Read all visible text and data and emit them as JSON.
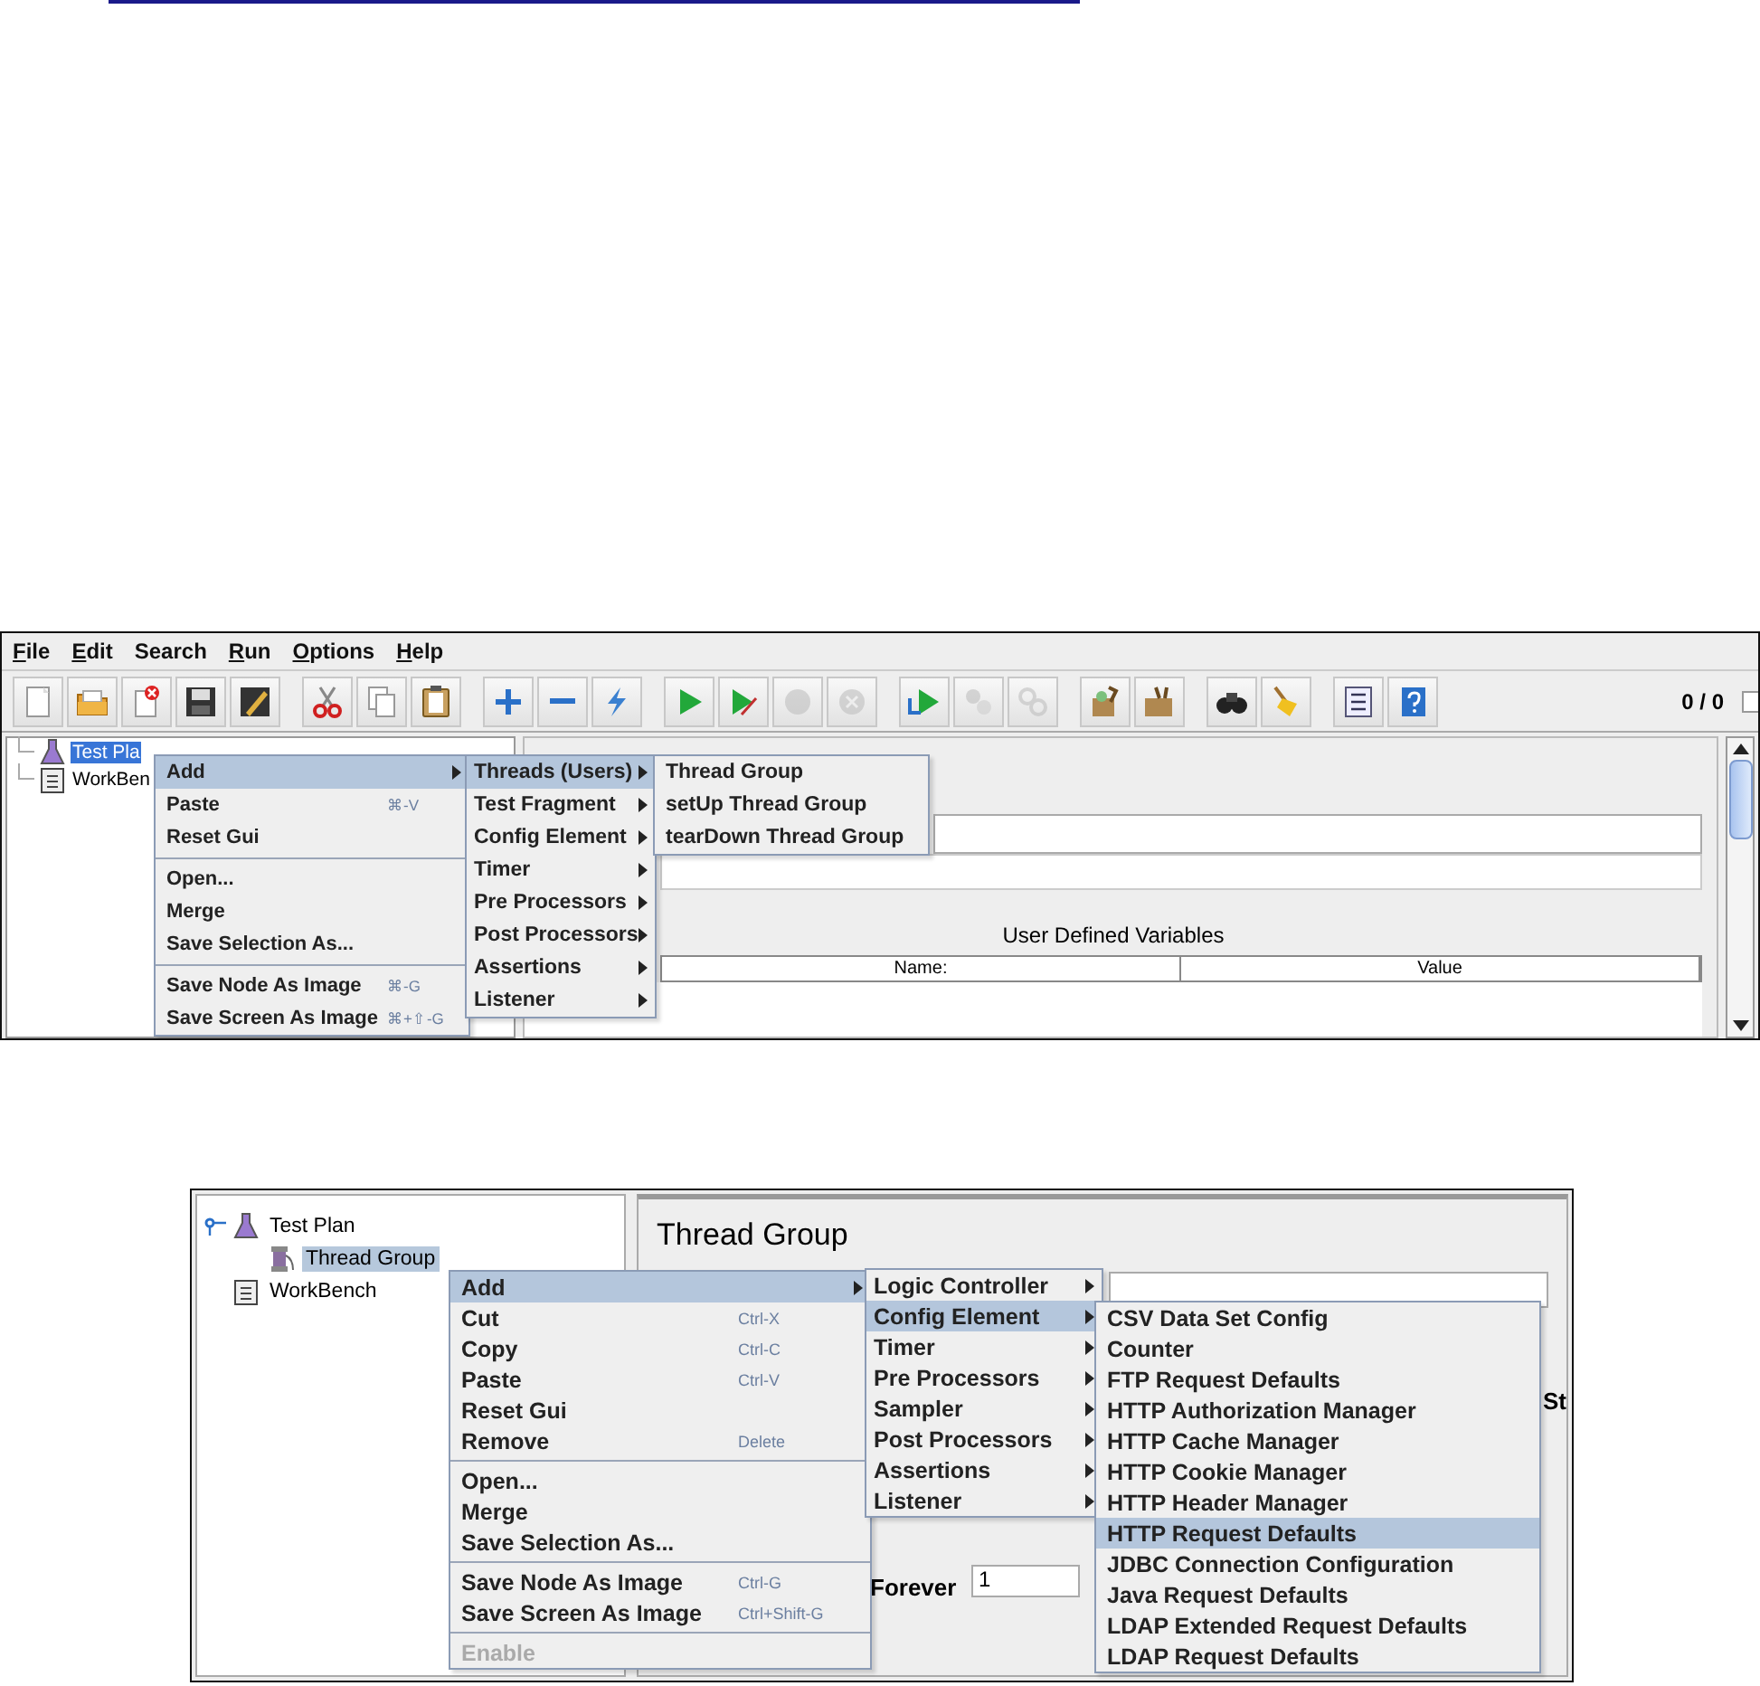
{
  "screenshot_1": {
    "menubar": [
      {
        "label": "File",
        "mnemonic": true
      },
      {
        "label": "Edit",
        "mnemonic": true
      },
      {
        "label": "Search",
        "mnemonic": false
      },
      {
        "label": "Run",
        "mnemonic": true
      },
      {
        "label": "Options",
        "mnemonic": true
      },
      {
        "label": "Help",
        "mnemonic": true
      }
    ],
    "toolbar_buttons": [
      {
        "disabled": false
      },
      {
        "disabled": false
      },
      {
        "disabled": false
      },
      {
        "disabled": false
      },
      {
        "disabled": false
      },
      {
        "disabled": false
      },
      {
        "disabled": false
      },
      {
        "disabled": false
      },
      {
        "disabled": false
      },
      {
        "disabled": false
      },
      {
        "disabled": false
      },
      {
        "disabled": false
      },
      {
        "disabled": false
      },
      {
        "disabled": true
      },
      {
        "disabled": true
      },
      {
        "disabled": false
      },
      {
        "disabled": true
      },
      {
        "disabled": true
      },
      {
        "disabled": false
      },
      {
        "disabled": false
      },
      {
        "disabled": false
      },
      {
        "disabled": false
      },
      {
        "disabled": false
      },
      {
        "disabled": false
      }
    ],
    "counter": "0 / 0",
    "tree": [
      {
        "label": "Test Pla",
        "selected": true
      },
      {
        "label": "WorkBen",
        "selected": false
      }
    ],
    "context_menu": {
      "items": [
        {
          "kind": "item",
          "label": "Add",
          "selected": true,
          "submenu": true
        },
        {
          "kind": "item",
          "label": "Paste",
          "shortcut": "⌘-V",
          "selected": false,
          "submenu": false
        },
        {
          "kind": "item",
          "label": "Reset Gui",
          "selected": false,
          "submenu": false
        },
        {
          "kind": "separator"
        },
        {
          "kind": "item",
          "label": "Open...",
          "selected": false,
          "submenu": false
        },
        {
          "kind": "item",
          "label": "Merge",
          "selected": false,
          "submenu": false
        },
        {
          "kind": "item",
          "label": "Save Selection As...",
          "selected": false,
          "submenu": false
        },
        {
          "kind": "separator"
        },
        {
          "kind": "item",
          "label": "Save Node As Image",
          "shortcut": "⌘-G",
          "selected": false,
          "submenu": false
        },
        {
          "kind": "item",
          "label": "Save Screen As Image",
          "shortcut": "⌘+⇧-G",
          "selected": false,
          "submenu": false
        }
      ]
    },
    "submenu_1": {
      "items": [
        {
          "kind": "item",
          "label": "Threads (Users)",
          "selected": true,
          "submenu": true
        },
        {
          "kind": "item",
          "label": "Test Fragment",
          "selected": false,
          "submenu": true
        },
        {
          "kind": "item",
          "label": "Config Element",
          "selected": false,
          "submenu": true
        },
        {
          "kind": "item",
          "label": "Timer",
          "selected": false,
          "submenu": true
        },
        {
          "kind": "item",
          "label": "Pre Processors",
          "selected": false,
          "submenu": true
        },
        {
          "kind": "item",
          "label": "Post Processors",
          "selected": false,
          "submenu": true
        },
        {
          "kind": "item",
          "label": "Assertions",
          "selected": false,
          "submenu": true
        },
        {
          "kind": "item",
          "label": "Listener",
          "selected": false,
          "submenu": true
        }
      ]
    },
    "submenu_2": {
      "items": [
        {
          "kind": "item",
          "label": "Thread Group",
          "selected": false,
          "submenu": false
        },
        {
          "kind": "item",
          "label": "setUp Thread Group",
          "selected": false,
          "submenu": false
        },
        {
          "kind": "item",
          "label": "tearDown Thread Group",
          "selected": false,
          "submenu": false
        }
      ]
    },
    "panel": {
      "table_title": "User Defined Variables",
      "columns": [
        "Name:",
        "Value"
      ]
    }
  },
  "screenshot_2": {
    "tree": [
      {
        "label": "Test Plan",
        "selected": false,
        "expanded": true,
        "children": [
          {
            "label": "Thread Group",
            "selected": true
          }
        ]
      },
      {
        "label": "WorkBench",
        "selected": false
      }
    ],
    "panel_title": "Thread Group",
    "partial_label": "St",
    "loop_label": "Forever",
    "loop_value": "1",
    "context_menu": {
      "items": [
        {
          "kind": "item",
          "label": "Add",
          "selected": true,
          "submenu": true,
          "disabled": false
        },
        {
          "kind": "item",
          "label": "Cut",
          "shortcut": "Ctrl-X",
          "selected": false,
          "submenu": false,
          "disabled": false
        },
        {
          "kind": "item",
          "label": "Copy",
          "shortcut": "Ctrl-C",
          "selected": false,
          "submenu": false,
          "disabled": false
        },
        {
          "kind": "item",
          "label": "Paste",
          "shortcut": "Ctrl-V",
          "selected": false,
          "submenu": false,
          "disabled": false
        },
        {
          "kind": "item",
          "label": "Reset Gui",
          "selected": false,
          "submenu": false,
          "disabled": false
        },
        {
          "kind": "item",
          "label": "Remove",
          "shortcut": "Delete",
          "selected": false,
          "submenu": false,
          "disabled": false
        },
        {
          "kind": "separator"
        },
        {
          "kind": "item",
          "label": "Open...",
          "selected": false,
          "submenu": false,
          "disabled": false
        },
        {
          "kind": "item",
          "label": "Merge",
          "selected": false,
          "submenu": false,
          "disabled": false
        },
        {
          "kind": "item",
          "label": "Save Selection As...",
          "selected": false,
          "submenu": false,
          "disabled": false
        },
        {
          "kind": "separator"
        },
        {
          "kind": "item",
          "label": "Save Node As Image",
          "shortcut": "Ctrl-G",
          "selected": false,
          "submenu": false,
          "disabled": false
        },
        {
          "kind": "item",
          "label": "Save Screen As Image",
          "shortcut": "Ctrl+Shift-G",
          "selected": false,
          "submenu": false,
          "disabled": false
        },
        {
          "kind": "separator"
        },
        {
          "kind": "item",
          "label": "Enable",
          "selected": false,
          "submenu": false,
          "disabled": true
        }
      ]
    },
    "submenu_1": {
      "items": [
        {
          "kind": "item",
          "label": "Logic Controller",
          "selected": false,
          "submenu": true
        },
        {
          "kind": "item",
          "label": "Config Element",
          "selected": true,
          "submenu": true
        },
        {
          "kind": "item",
          "label": "Timer",
          "selected": false,
          "submenu": true
        },
        {
          "kind": "item",
          "label": "Pre Processors",
          "selected": false,
          "submenu": true
        },
        {
          "kind": "item",
          "label": "Sampler",
          "selected": false,
          "submenu": true
        },
        {
          "kind": "item",
          "label": "Post Processors",
          "selected": false,
          "submenu": true
        },
        {
          "kind": "item",
          "label": "Assertions",
          "selected": false,
          "submenu": true
        },
        {
          "kind": "item",
          "label": "Listener",
          "selected": false,
          "submenu": true
        }
      ]
    },
    "submenu_2": {
      "items": [
        {
          "kind": "item",
          "label": "CSV Data Set Config",
          "selected": false,
          "submenu": false
        },
        {
          "kind": "item",
          "label": "Counter",
          "selected": false,
          "submenu": false
        },
        {
          "kind": "item",
          "label": "FTP Request Defaults",
          "selected": false,
          "submenu": false
        },
        {
          "kind": "item",
          "label": "HTTP Authorization Manager",
          "selected": false,
          "submenu": false
        },
        {
          "kind": "item",
          "label": "HTTP Cache Manager",
          "selected": false,
          "submenu": false
        },
        {
          "kind": "item",
          "label": "HTTP Cookie Manager",
          "selected": false,
          "submenu": false
        },
        {
          "kind": "item",
          "label": "HTTP Header Manager",
          "selected": false,
          "submenu": false
        },
        {
          "kind": "item",
          "label": "HTTP Request Defaults",
          "selected": true,
          "submenu": false
        },
        {
          "kind": "item",
          "label": "JDBC Connection Configuration",
          "selected": false,
          "submenu": false
        },
        {
          "kind": "item",
          "label": "Java Request Defaults",
          "selected": false,
          "submenu": false
        },
        {
          "kind": "item",
          "label": "LDAP Extended Request Defaults",
          "selected": false,
          "submenu": false
        },
        {
          "kind": "item",
          "label": "LDAP Request Defaults",
          "selected": false,
          "submenu": false
        }
      ]
    }
  }
}
